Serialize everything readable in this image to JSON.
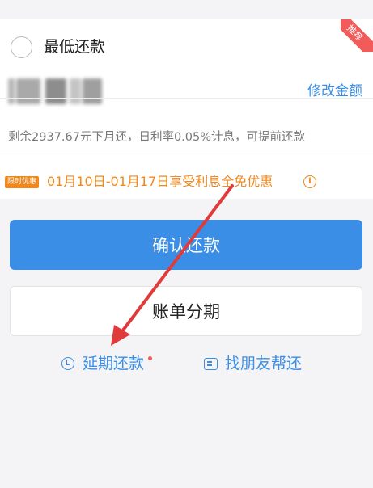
{
  "repay_option": {
    "label": "最低还款",
    "badge": "推荐",
    "edit_amount_label": "修改金额",
    "remaining_text": "剩余2937.67元下月还，日利率0.05%计息，可提前还款"
  },
  "promo": {
    "tag": "限时优惠",
    "text": "01月10日-01月17日享受利息全免优惠"
  },
  "actions": {
    "confirm_label": "确认还款",
    "installment_label": "账单分期",
    "defer_label": "延期还款",
    "friend_label": "找朋友帮还"
  },
  "colors": {
    "accent": "#3a8ee6",
    "promo": "#f0881e",
    "badge": "#f35a5a",
    "annotation_arrow": "#e03a3a"
  }
}
